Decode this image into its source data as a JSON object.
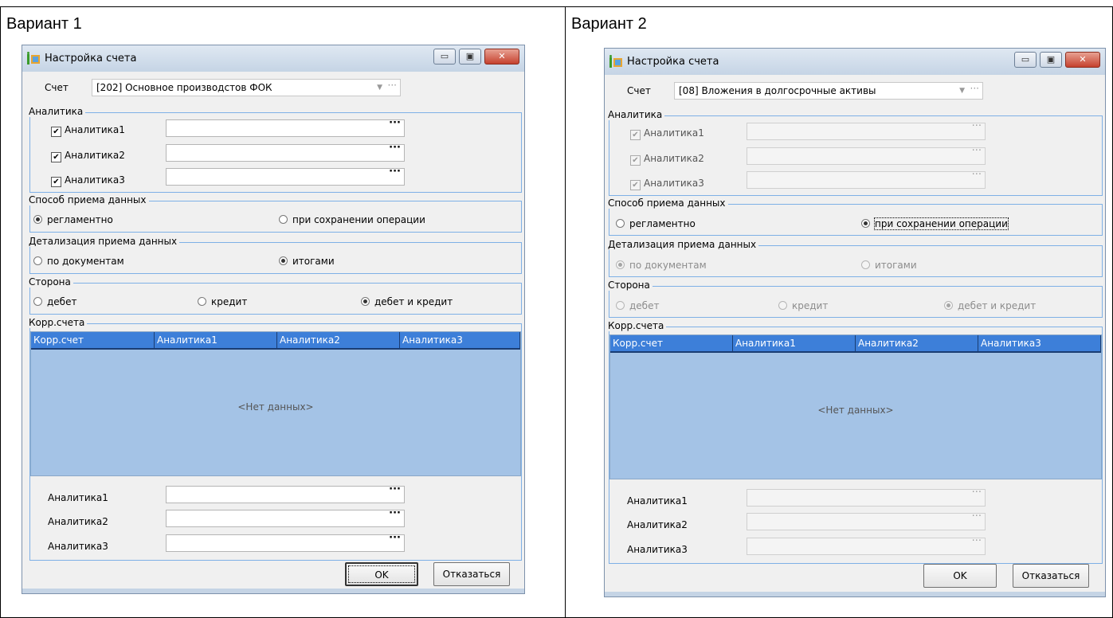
{
  "variant1": {
    "caption": "Вариант 1",
    "title": "Настройка счета",
    "window_buttons": {
      "minimize": "▭",
      "maximize": "▣",
      "close": "✕"
    },
    "account_label": "Счет",
    "account_value": "[202] Основное производстов ФОК",
    "analytics_group": "Аналитика",
    "analytics": [
      {
        "label": "Аналитика1",
        "checked": "✔"
      },
      {
        "label": "Аналитика2",
        "checked": "✔"
      },
      {
        "label": "Аналитика3",
        "checked": "✔"
      }
    ],
    "method_group": "Способ приема данных",
    "method_options": [
      "регламентно",
      "при сохранении операции"
    ],
    "method_selected": "регламентно",
    "detail_group": "Детализация приема данных",
    "detail_options": [
      "по документам",
      "итогами"
    ],
    "detail_selected": "итогами",
    "side_group": "Сторона",
    "side_options": [
      "дебет",
      "кредит",
      "дебет и кредит"
    ],
    "side_selected": "дебет и кредит",
    "corr_group": "Корр.счета",
    "columns": [
      "Корр.счет",
      "Аналитика1",
      "Аналитика2",
      "Аналитика3"
    ],
    "empty_text": "<Нет данных>",
    "bottom_analytics": [
      "Аналитика1",
      "Аналитика2",
      "Аналитика3"
    ],
    "ok_label": "OK",
    "cancel_label": "Отказаться"
  },
  "variant2": {
    "caption": "Вариант 2",
    "title": "Настройка счета",
    "window_buttons": {
      "minimize": "▭",
      "maximize": "▣",
      "close": "✕"
    },
    "account_label": "Счет",
    "account_value": "[08] Вложения в долгосрочные активы",
    "analytics_group": "Аналитика",
    "analytics": [
      {
        "label": "Аналитика1",
        "checked": "✔"
      },
      {
        "label": "Аналитика2",
        "checked": "✔"
      },
      {
        "label": "Аналитика3",
        "checked": "✔"
      }
    ],
    "method_group": "Способ приема данных",
    "method_options": [
      "регламентно",
      "при сохранении операции"
    ],
    "method_selected": "при сохранении операции",
    "detail_group": "Детализация приема данных",
    "detail_options": [
      "по документам",
      "итогами"
    ],
    "detail_selected": "по документам",
    "side_group": "Сторона",
    "side_options": [
      "дебет",
      "кредит",
      "дебет и кредит"
    ],
    "side_selected": "дебет и кредит",
    "corr_group": "Корр.счета",
    "columns": [
      "Корр.счет",
      "Аналитика1",
      "Аналитика2",
      "Аналитика3"
    ],
    "empty_text": "<Нет данных>",
    "bottom_analytics": [
      "Аналитика1",
      "Аналитика2",
      "Аналитика3"
    ],
    "ok_label": "OK",
    "cancel_label": "Отказаться"
  },
  "colors": {
    "grid_header": "#3d7fd9",
    "grid_body": "#a4c3e6",
    "group_border": "#7eb0e6",
    "dialog_bg": "#f0f0f0"
  }
}
